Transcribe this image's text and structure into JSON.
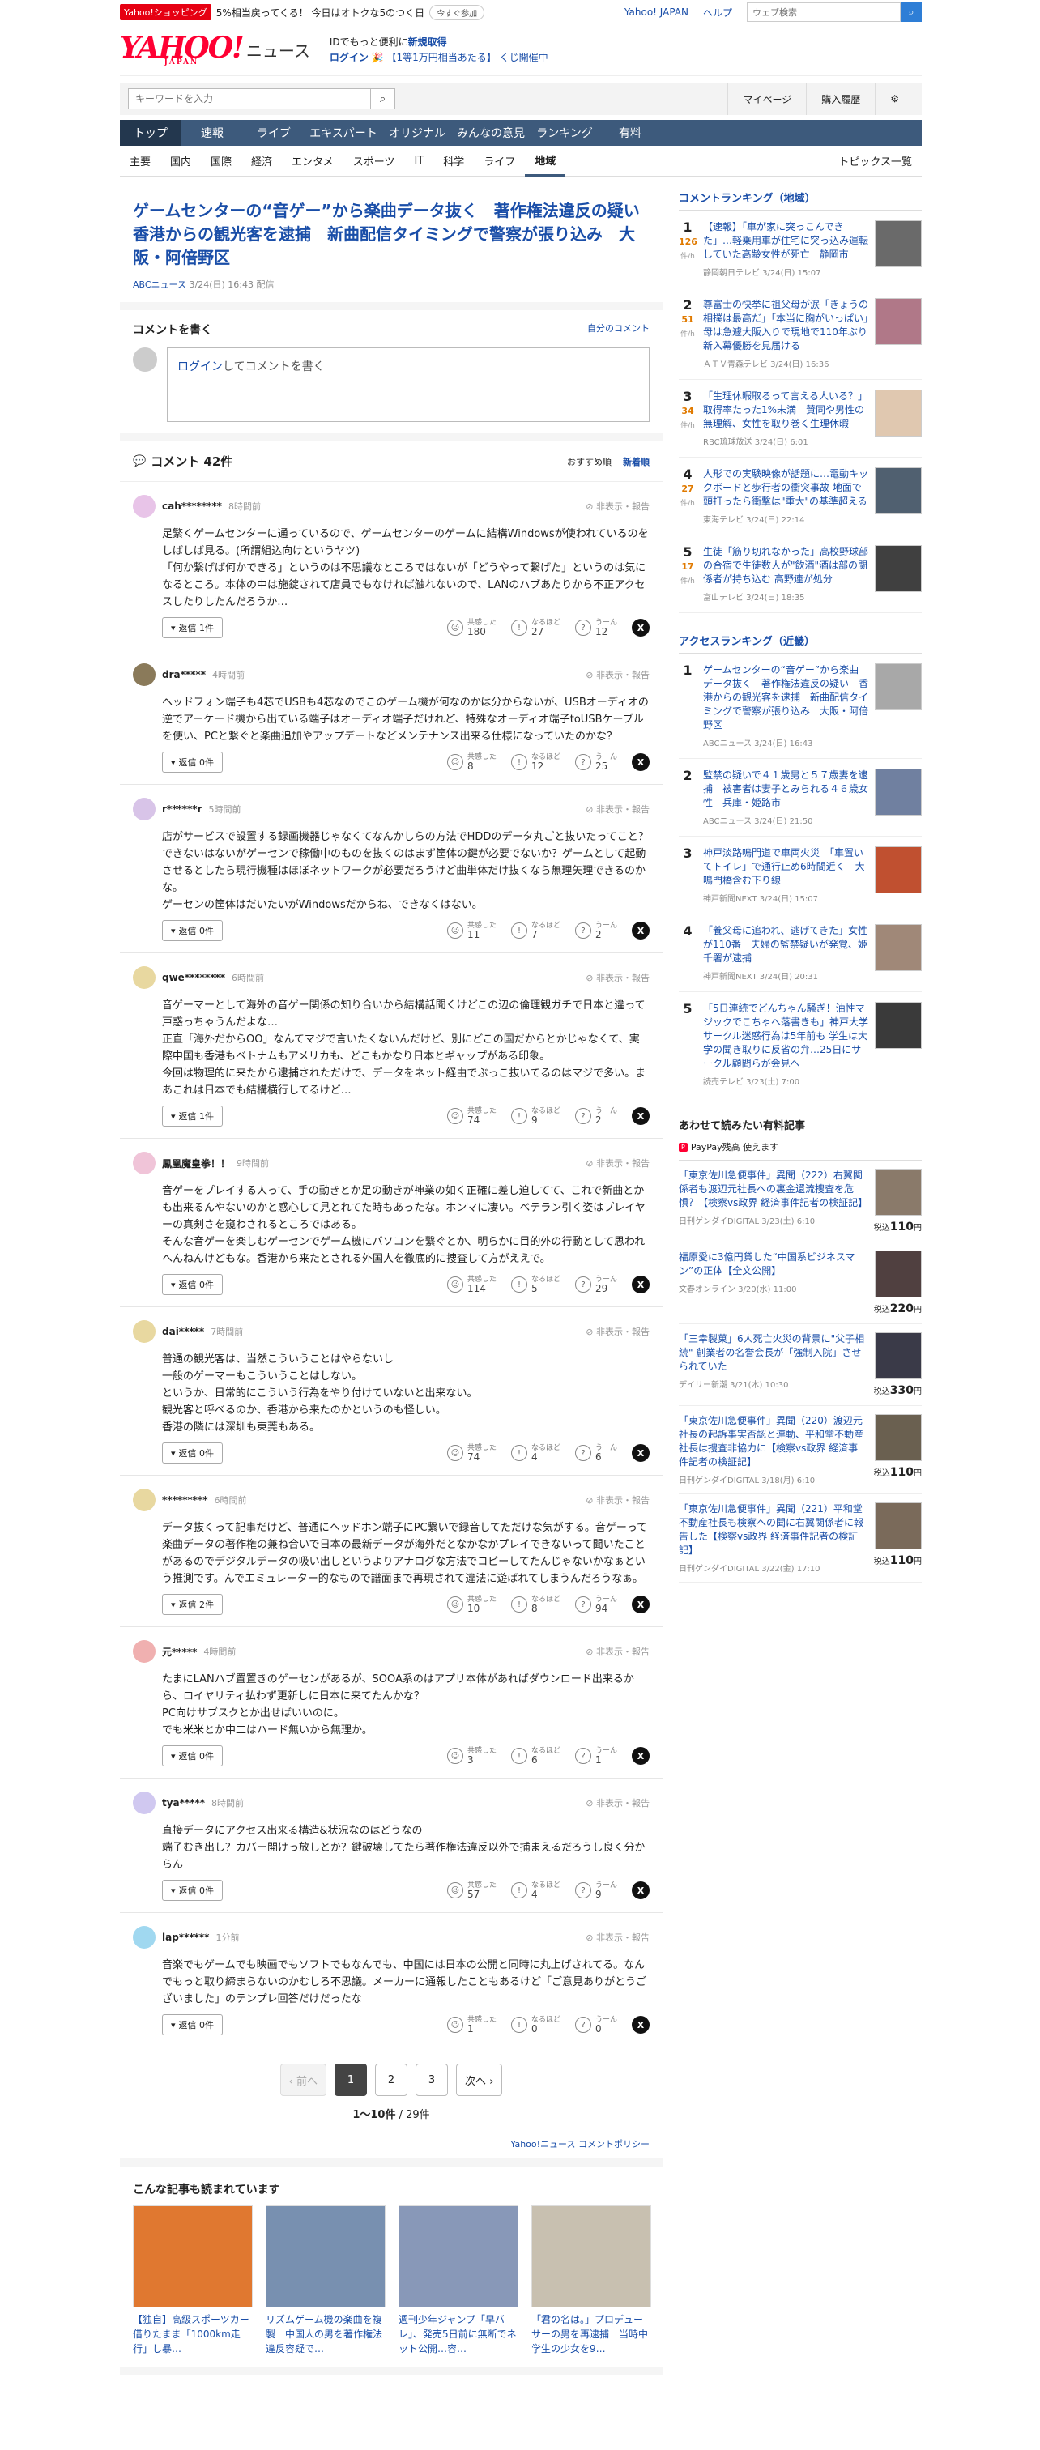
{
  "promo": {
    "badge": "Yahoo!ショッピング",
    "text": "5%相当戻ってくる！ 今日はオトクな5のつく日",
    "btn": "今すぐ参加",
    "links": [
      "Yahoo! JAPAN",
      "ヘルプ"
    ],
    "search_placeholder": "ウェブ検索"
  },
  "header": {
    "logo": "YAHOO!",
    "logo_sub": "JAPAN",
    "news": "ニュース",
    "line1_pre": "IDでもっと便利に",
    "line1_link": "新規取得",
    "line2_login": "ログイン",
    "line2_lottery": "【1等1万円相当あたる】 くじ開催中"
  },
  "sband": {
    "placeholder": "キーワードを入力",
    "mypage": "マイページ",
    "purchase": "購入履歴"
  },
  "mainnav": [
    "トップ",
    "速報",
    "ライブ",
    "エキスパート",
    "オリジナル",
    "みんなの意見",
    "ランキング",
    "有料"
  ],
  "subnav": [
    "主要",
    "国内",
    "国際",
    "経済",
    "エンタメ",
    "スポーツ",
    "IT",
    "科学",
    "ライフ",
    "地域"
  ],
  "subnav_topics": "トピックス一覧",
  "article": {
    "title": "ゲームセンターの“音ゲー”から楽曲データ抜く　著作権法違反の疑い　香港からの観光客を逮捕　新曲配信タイミングで警察が張り込み　大阪・阿倍野区",
    "source": "ABCニュース",
    "date": "3/24(日) 16:43 配信"
  },
  "write": {
    "heading": "コメントを書く",
    "own": "自分のコメント",
    "login": "ログイン",
    "placeholder": "してコメントを書く"
  },
  "comments_header": {
    "count": "コメント 42件",
    "sort_rec": "おすすめ順",
    "sort_new": "新着順"
  },
  "comment_labels": {
    "report": "非表示・報告",
    "agree": "共感した",
    "ok": "なるほど",
    "hmm": "うーん"
  },
  "comments": [
    {
      "name": "cah********",
      "time": "8時間前",
      "color": "#e8c4e8",
      "text": "足繁くゲームセンターに通っているので、ゲームセンターのゲームに結構Windowsが使われているのをしばしば見る。(所謂組込向けというヤツ)\n「何か繋げば何かできる」というのは不思議なところではないが「どうやって繋げた」というのは気になるところ。本体の中は施錠されて店員でもなければ触れないので、LANのハブあたりから不正アクセスしたりしたんだろうか…",
      "reply": "返信 1件",
      "agree": "180",
      "ok": "27",
      "hmm": "12"
    },
    {
      "name": "dra*****",
      "time": "4時間前",
      "color": "#8a7a5a",
      "text": "ヘッドフォン端子も4芯でUSBも4芯なのでこのゲーム機が何なのかは分からないが、USBオーディオの逆でアーケード機から出ている端子はオーディオ端子だけれど、特殊なオーディオ端子toUSBケーブルを使い、PCと繋ぐと楽曲追加やアップデートなどメンテナンス出来る仕様になっていたのかな？",
      "reply": "返信 0件",
      "agree": "8",
      "ok": "12",
      "hmm": "25"
    },
    {
      "name": "r******r",
      "time": "5時間前",
      "color": "#d8c4e8",
      "text": "店がサービスで設置する録画機器じゃなくてなんかしらの方法でHDDのデータ丸ごと抜いたってこと？\nできないはないがゲーセンで稼働中のものを抜くのはまず筐体の鍵が必要でないか？ゲームとして起動させるとしたら現行機種はほぼネットワークが必要だろうけど曲単体だけ抜くなら無理矢理できるのかな。\nゲーセンの筐体はだいたいがWindowsだからね、できなくはない。",
      "reply": "返信 0件",
      "agree": "11",
      "ok": "7",
      "hmm": "2"
    },
    {
      "name": "qwe********",
      "time": "6時間前",
      "color": "#e8d8a0",
      "text": "音ゲーマーとして海外の音ゲー関係の知り合いから結構話聞くけどこの辺の倫理観ガチで日本と違って戸惑っちゃうんだよな…\n正直「海外だからOO」なんてマジで言いたくないんだけど、別にどこの国だからとかじゃなくて、実際中国も香港もベトナムもアメリカも、どこもかなり日本とギャップがある印象。\n今回は物理的に来たから逮捕されただけで、データをネット経由でぶっこ抜いてるのはマジで多い。まあこれは日本でも結構横行してるけど…",
      "reply": "返信 1件",
      "agree": "74",
      "ok": "9",
      "hmm": "2"
    },
    {
      "name": "鳳凰魔皇拳！！",
      "time": "9時間前",
      "color": "#f0c4d8",
      "text": "音ゲーをプレイする人って、手の動きとか足の動きが神業の如く正確に差し迫してて、これで新曲とかも出来るんやないのかと感心して見とれてた時もあったな。ホンマに凄い。ベテラン引く姿はプレイヤーの真剣さを窺わされるところではある。\nそんな音ゲーを楽しむゲーセンでゲーム機にパソコンを繋ぐとか、明らかに目的外の行動として思われへんねんけどもな。香港から来たとされる外国人を徹底的に捜査して方がええで。",
      "reply": "返信 0件",
      "agree": "114",
      "ok": "5",
      "hmm": "29"
    },
    {
      "name": "dai*****",
      "time": "7時間前",
      "color": "#e8d8a0",
      "text": "普通の観光客は、当然こういうことはやらないし\n一般のゲーマーもこういうことはしない。\nというか、日常的にこういう行為をやり付けていないと出来ない。\n観光客と呼べるのか、香港から来たのかというのも怪しい。\n香港の隣には深圳も東莞もある。",
      "reply": "返信 0件",
      "agree": "74",
      "ok": "4",
      "hmm": "6"
    },
    {
      "name": "*********",
      "time": "6時間前",
      "color": "#e8d8a0",
      "text": "データ抜くって記事だけど、普通にヘッドホン端子にPC繋いで録音してただけな気がする。音ゲーって楽曲データの著作権の兼ね合いで日本の最新データが海外だとなかなかプレイできないって聞いたことがあるのでデジタルデータの吸い出しというよりアナログな方法でコピーしてたんじゃないかなぁという推測です。んでエミュレーター的なもので譜面まで再現されて違法に遊ばれてしまうんだろうなぁ。",
      "reply": "返信 2件",
      "agree": "10",
      "ok": "8",
      "hmm": "94"
    },
    {
      "name": "元*****",
      "time": "4時間前",
      "color": "#f0b0b0",
      "text": "たまにLANハブ置置きのゲーセンがあるが、SOOA系のはアプリ本体があればダウンロード出来るから、ロイヤリティ払わず更新しに日本に来てたんかな？\nPC向けサブスクとか出せばいいのに。\nでも米米とか中二はハード無いから無理か。",
      "reply": "返信 0件",
      "agree": "3",
      "ok": "6",
      "hmm": "1"
    },
    {
      "name": "tya*****",
      "time": "8時間前",
      "color": "#d0c8f0",
      "text": "直接データにアクセス出来る構造&状況なのはどうなの\n端子むき出し？カバー開けっ放しとか？鍵破壊してたら著作権法違反以外で捕まえるだろうし良く分からん",
      "reply": "返信 0件",
      "agree": "57",
      "ok": "4",
      "hmm": "9"
    },
    {
      "name": "lap******",
      "time": "1分前",
      "color": "#a0d8f0",
      "text": "音楽でもゲームでも映画でもソフトでもなんでも、中国には日本の公開と同時に丸上げされてる。なんでもっと取り締まらないのかむしろ不思議。メーカーに通報したこともあるけど「ご意見ありがとうございました」のテンプレ回答だけだったな",
      "reply": "返信 0件",
      "agree": "1",
      "ok": "0",
      "hmm": "0"
    }
  ],
  "pager": {
    "prev": "‹ 前へ",
    "pages": [
      "1",
      "2",
      "3"
    ],
    "next": "次へ ›",
    "info": "1〜10件",
    "total": " / 29件",
    "policy": "Yahoo!ニュース コメントポリシー"
  },
  "related": {
    "heading": "こんな記事も読まれています",
    "items": [
      {
        "title": "【独自】高級スポーツカー借りたまま「1000km走行」し暴…",
        "bg": "#e07830"
      },
      {
        "title": "リズムゲーム機の楽曲を複製　中国人の男を著作権法違反容疑で…",
        "bg": "#7890b0"
      },
      {
        "title": "週刊少年ジャンプ「早バレ」、発売5日前に無断でネット公開…容…",
        "bg": "#8898b8"
      },
      {
        "title": "「君の名は。」プロデューサーの男を再逮捕　当時中学生の少女を9…",
        "bg": "#c8c0b0"
      }
    ]
  },
  "right": {
    "comment_rank_title": "コメントランキング（地域）",
    "comment_rank": [
      {
        "no": "1",
        "count": "126",
        "unit": "件/h",
        "title": "【速報】「車が家に突っこんできた」…軽乗用車が住宅に突っ込み運転していた高齢女性が死亡　静岡市",
        "meta": "静岡朝日テレビ 3/24(日) 15:07",
        "bg": "#6a6a6a"
      },
      {
        "no": "2",
        "count": "51",
        "unit": "件/h",
        "title": "尊富士の快挙に祖父母が涙「きょうの相撲は最高だ」「本当に胸がいっぱい」　母は急遽大阪入りで現地で110年ぶり新入幕優勝を見届ける",
        "meta": "ＡＴＶ青森テレビ 3/24(日) 16:36",
        "bg": "#b07888"
      },
      {
        "no": "3",
        "count": "34",
        "unit": "件/h",
        "title": "「生理休暇取るって言える人いる？」取得率たった1%未満　賛同や男性の無理解、女性を取り巻く生理休暇",
        "meta": "RBC琉球放送 3/24(日) 6:01",
        "bg": "#e0c8b0"
      },
      {
        "no": "4",
        "count": "27",
        "unit": "件/h",
        "title": "人形での実験映像が話題に…電動キックボードと歩行者の衝突事故 地面で頭打ったら衝撃は\"重大\"の基準超える",
        "meta": "東海テレビ 3/24(日) 22:14",
        "bg": "#506070"
      },
      {
        "no": "5",
        "count": "17",
        "unit": "件/h",
        "title": "生徒「筋り切れなかった」高校野球部の合宿で生徒数人が\"飲酒\"酒は部の関係者が持ち込む 高野連が処分",
        "meta": "富山テレビ 3/24(日) 18:35",
        "bg": "#404040"
      }
    ],
    "access_rank_title": "アクセスランキング（近畿）",
    "access_rank": [
      {
        "no": "1",
        "title": "ゲームセンターの“音ゲー”から楽曲データ抜く　著作権法違反の疑い　香港からの観光客を逮捕　新曲配信タイミングで警察が張り込み　大阪・阿倍野区",
        "meta": "ABCニュース 3/24(日) 16:43",
        "bg": "#a8a8a8"
      },
      {
        "no": "2",
        "title": "監禁の疑いで４１歳男と５７歳妻を逮捕　被害者は妻子とみられる４６歳女性　兵庫・姫路市",
        "meta": "ABCニュース 3/24(日) 21:50",
        "bg": "#7080a0"
      },
      {
        "no": "3",
        "title": "神戸淡路鳴門道で車両火災　「車置いてトイレ」で通行止め6時間近く　大鳴門橋含む下り線",
        "meta": "神戸新聞NEXT 3/24(日) 15:07",
        "bg": "#c05030"
      },
      {
        "no": "4",
        "title": "「養父母に追われ、逃げてきた」女性が110番　夫婦の監禁疑いが発覚、姫千署が逮捕",
        "meta": "神戸新聞NEXT 3/24(日) 20:31",
        "bg": "#a08878"
      },
      {
        "no": "5",
        "title": "「5日連続でどんちゃん騒ぎ！油性マジックでこちゃへ落書きも」神戸大学サークル迷惑行為は5年前も 学生は大学の聞き取りに反省の弁…25日にサークル顧問らが会見へ",
        "meta": "読売テレビ 3/23(土) 7:00",
        "bg": "#3a3a3a"
      }
    ],
    "paid_title": "あわせて読みたい有料記事",
    "paypay": "PayPay残高 使えます",
    "paid": [
      {
        "title": "「東京佐川急便事件」異聞（222）右翼関係者も渡辺元社長への裏金還流捜査を危惧？【検察vs政界 経済事件記者の検証記】",
        "meta": "日刊ゲンダイDIGITAL 3/23(土) 6:10",
        "price": "110",
        "bg": "#8a7a6a"
      },
      {
        "title": "福原愛に3億円貸した“中国系ビジネスマン”の正体【全文公開】",
        "meta": "文春オンライン 3/20(水) 11:00",
        "price": "220",
        "bg": "#504040"
      },
      {
        "title": "「三幸製菓」6人死亡火災の背景に\"父子相続\" 創業者の名誉会長が「強制入院」させられていた",
        "meta": "デイリー新潮 3/21(木) 10:30",
        "price": "330",
        "bg": "#3a3a48"
      },
      {
        "title": "「東京佐川急便事件」異聞（220）渡辺元社長の起訴事実否認と連動、平和堂不動産社長は捜査非協力に【検察vs政界 経済事件記者の検証記】",
        "meta": "日刊ゲンダイDIGITAL 3/18(月) 6:10",
        "price": "110",
        "bg": "#6a6050"
      },
      {
        "title": "「東京佐川急便事件」異聞（221）平和堂不動産社長も検察への聞に右翼関係者に報告した【検察vs政界 経済事件記者の検証記】",
        "meta": "日刊ゲンダイDIGITAL 3/22(金) 17:10",
        "price": "110",
        "bg": "#7a6a5a"
      }
    ],
    "price_prefix": "税込",
    "price_suffix": "円"
  }
}
